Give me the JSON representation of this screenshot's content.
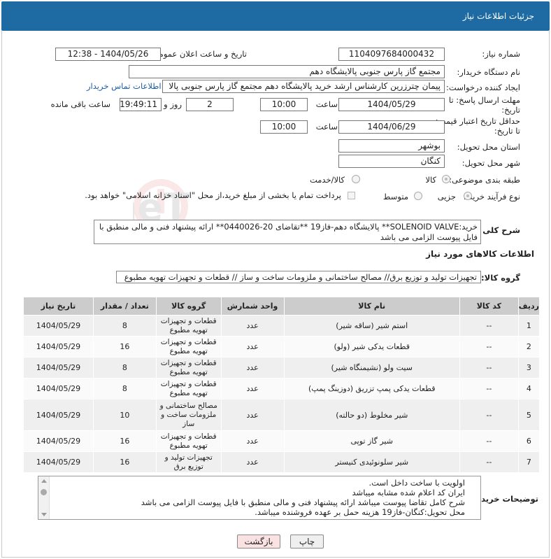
{
  "header": {
    "title": "جزئیات اطلاعات نیاز"
  },
  "form": {
    "need_number_label": "شماره نیاز:",
    "need_number": "1104097684000432",
    "announce_label": "تاریخ و ساعت اعلان عمومی:",
    "announce_value": "1404/05/26 - 12:38",
    "buyer_org_label": "نام دستگاه خریدار:",
    "buyer_org": "مجتمع گاز پارس جنوبی  پالایشگاه دهم",
    "requester_label": "ایجاد کننده درخواست:",
    "requester": "پیمان چترزرین کارشناس ارشد خرید پالایشگاه دهم مجتمع گاز پارس جنوبی  پالا",
    "contact_link": "اطلاعات تماس خریدار",
    "reply_deadline_label": "مهلت ارسال پاسخ: تا تاریخ:",
    "reply_date": "1404/05/29",
    "time_label": "ساعت",
    "reply_time": "10:00",
    "days_count": "2",
    "days_label": "روز و",
    "remaining_time": "19:49:11",
    "remaining_label": "ساعت باقی مانده",
    "price_validity_label": "حداقل تاریخ اعتبار قیمت: تا تاریخ:",
    "price_date": "1404/06/29",
    "price_time": "10:00",
    "province_label": "استان محل تحویل:",
    "province": "بوشهر",
    "city_label": "شهر محل تحویل:",
    "city": "کنگان",
    "category_label": "طبقه بندی موضوعی:",
    "category_goods": "کالا",
    "category_goods_service": "کالا/خدمت",
    "process_label": "نوع فرآیند خرید :",
    "process_partial": "جزیی",
    "process_medium": "متوسط",
    "payment_note": "پرداخت تمام یا بخشی از مبلغ خرید،از محل \"اسناد خزانه اسلامی\" خواهد بود."
  },
  "description": {
    "label": "شرح کلی نیاز:",
    "text": "خرید:SOLENOID VALVE** پالایشگاه دهم-فاز19 **تقاضای 20-0440026** ارائه پیشنهاد فنی و مالی منطبق با فایل پیوست الزامی می باشد"
  },
  "goods_section": {
    "title": "اطلاعات کالاهای مورد نیاز",
    "group_label": "گروه کالا:",
    "group_value": "تجهیزات تولید و توزیع برق// مصالح ساختمانی و ملزومات ساخت و ساز //  قطعات و تجهیزات تهویه مطبوع"
  },
  "table": {
    "headers": [
      "ردیف",
      "کد کالا",
      "نام کالا",
      "واحد شمارش",
      "گروه کالا",
      "تعداد / مقدار",
      "تاریخ نیاز"
    ],
    "rows": [
      {
        "idx": "1",
        "code": "--",
        "name": "استم شیر (ساقه شیر)",
        "unit": "عدد",
        "group": "قطعات و تجهیزات تهویه مطبوع",
        "qty": "8",
        "date": "1404/05/29"
      },
      {
        "idx": "2",
        "code": "--",
        "name": "قطعات یدکی شیر (ولو)",
        "unit": "عدد",
        "group": "قطعات و تجهیزات تهویه مطبوع",
        "qty": "16",
        "date": "1404/05/29"
      },
      {
        "idx": "3",
        "code": "--",
        "name": "سیت ولو (نشیمنگاه شیر)",
        "unit": "عدد",
        "group": "قطعات و تجهیزات تهویه مطبوع",
        "qty": "8",
        "date": "1404/05/29"
      },
      {
        "idx": "4",
        "code": "--",
        "name": "قطعات یدکی پمپ تزریق (دوزینگ پمپ)",
        "unit": "عدد",
        "group": "قطعات و تجهیزات تهویه مطبوع",
        "qty": "8",
        "date": "1404/05/29"
      },
      {
        "idx": "5",
        "code": "--",
        "name": "شیر مخلوط (دو حالته)",
        "unit": "عدد",
        "group": "مصالح ساختمانی و ملزومات ساخت و ساز",
        "qty": "10",
        "date": "1404/05/29"
      },
      {
        "idx": "6",
        "code": "--",
        "name": "شیر گاز توپی",
        "unit": "عدد",
        "group": "قطعات و تجهیزات تهویه مطبوع",
        "qty": "16",
        "date": "1404/05/29"
      },
      {
        "idx": "7",
        "code": "--",
        "name": "شیر سلونوئیدی کنیستر",
        "unit": "عدد",
        "group": "تجهیزات تولید و توزیع برق",
        "qty": "16",
        "date": "1404/05/29"
      }
    ]
  },
  "notes": {
    "label": "توضیحات خریدار:",
    "lines": [
      "اولویت با ساخت داخل است.",
      "ایران کد اعلام شده مشابه میباشد",
      "شرح کامل تقاضا پیوست میباشد ارائه پیشنهاد فنی و مالی منطبق با فایل پیوست الزامی می باشد",
      "محل تحویل:کنگان-فاز19 هزینه حمل بر عهده فروشنده میباشد."
    ]
  },
  "buttons": {
    "print": "چاپ",
    "back": "بازگشت"
  },
  "watermark": {
    "text": "AriaTender.neT"
  }
}
